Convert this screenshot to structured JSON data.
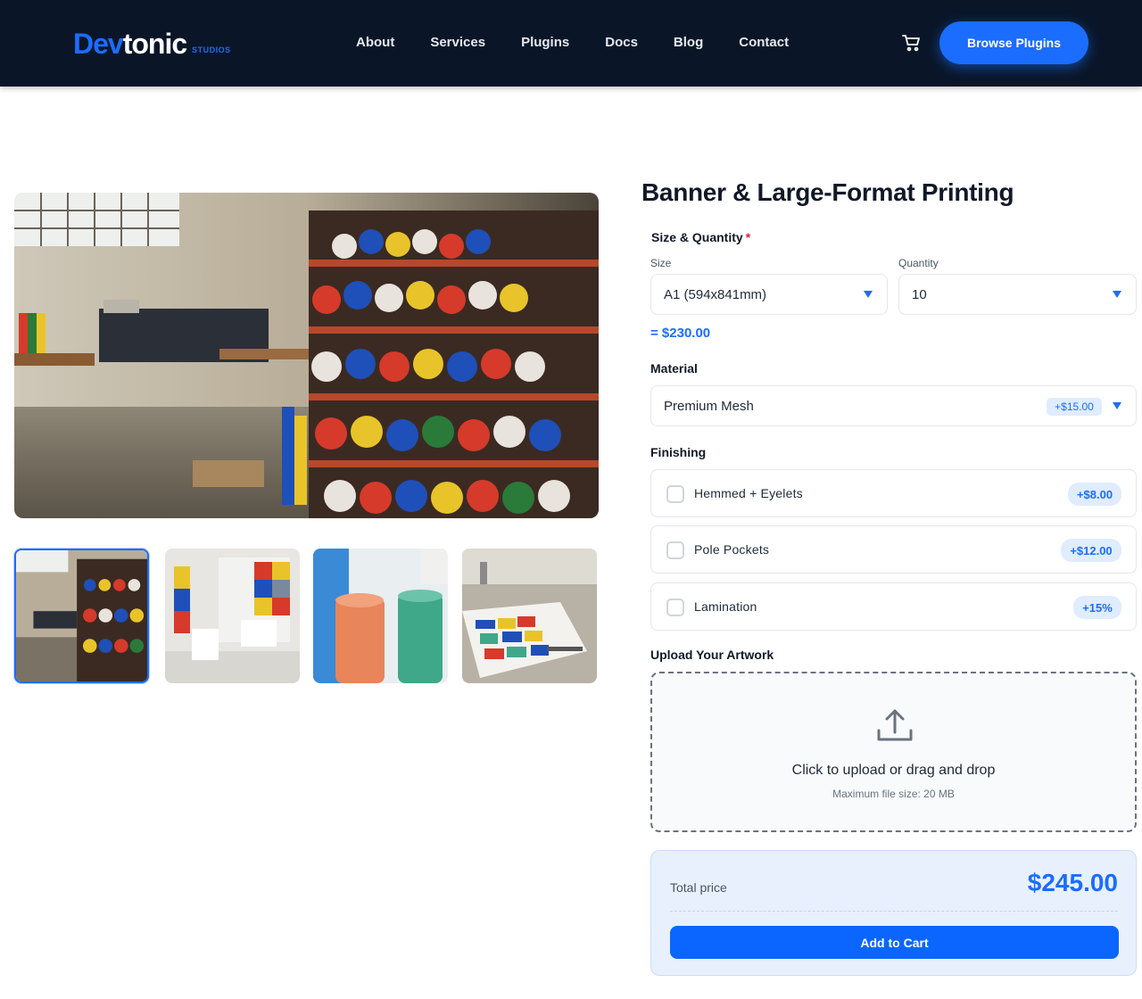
{
  "header": {
    "logo": {
      "dev": "Dev",
      "tonic": "tonic",
      "studios": "STUDIOS"
    },
    "nav": [
      "About",
      "Services",
      "Plugins",
      "Docs",
      "Blog",
      "Contact"
    ],
    "cta": "Browse Plugins"
  },
  "product": {
    "title": "Banner & Large-Format Printing",
    "size_quantity_label": "Size & Quantity",
    "required_mark": "*",
    "size_label": "Size",
    "size_value": "A1 (594x841mm)",
    "quantity_label": "Quantity",
    "quantity_value": "10",
    "subtotal": "= $230.00",
    "material_label": "Material",
    "material_value": "Premium Mesh",
    "material_badge": "+$15.00",
    "finishing_label": "Finishing",
    "finishing": [
      {
        "label": "Hemmed + Eyelets",
        "price": "+$8.00"
      },
      {
        "label": "Pole Pockets",
        "price": "+$12.00"
      },
      {
        "label": "Lamination",
        "price": "+15%"
      }
    ],
    "upload_label": "Upload Your Artwork",
    "upload_main": "Click to upload or drag and drop",
    "upload_sub": "Maximum file size: 20 MB",
    "total_label": "Total price",
    "total_value": "$245.00",
    "add_to_cart": "Add to Cart"
  },
  "colors": {
    "accent": "#1a6dff",
    "header_bg": "#0a1628"
  },
  "icons": [
    "cart-icon",
    "upload-icon",
    "dropdown-caret-icon"
  ]
}
